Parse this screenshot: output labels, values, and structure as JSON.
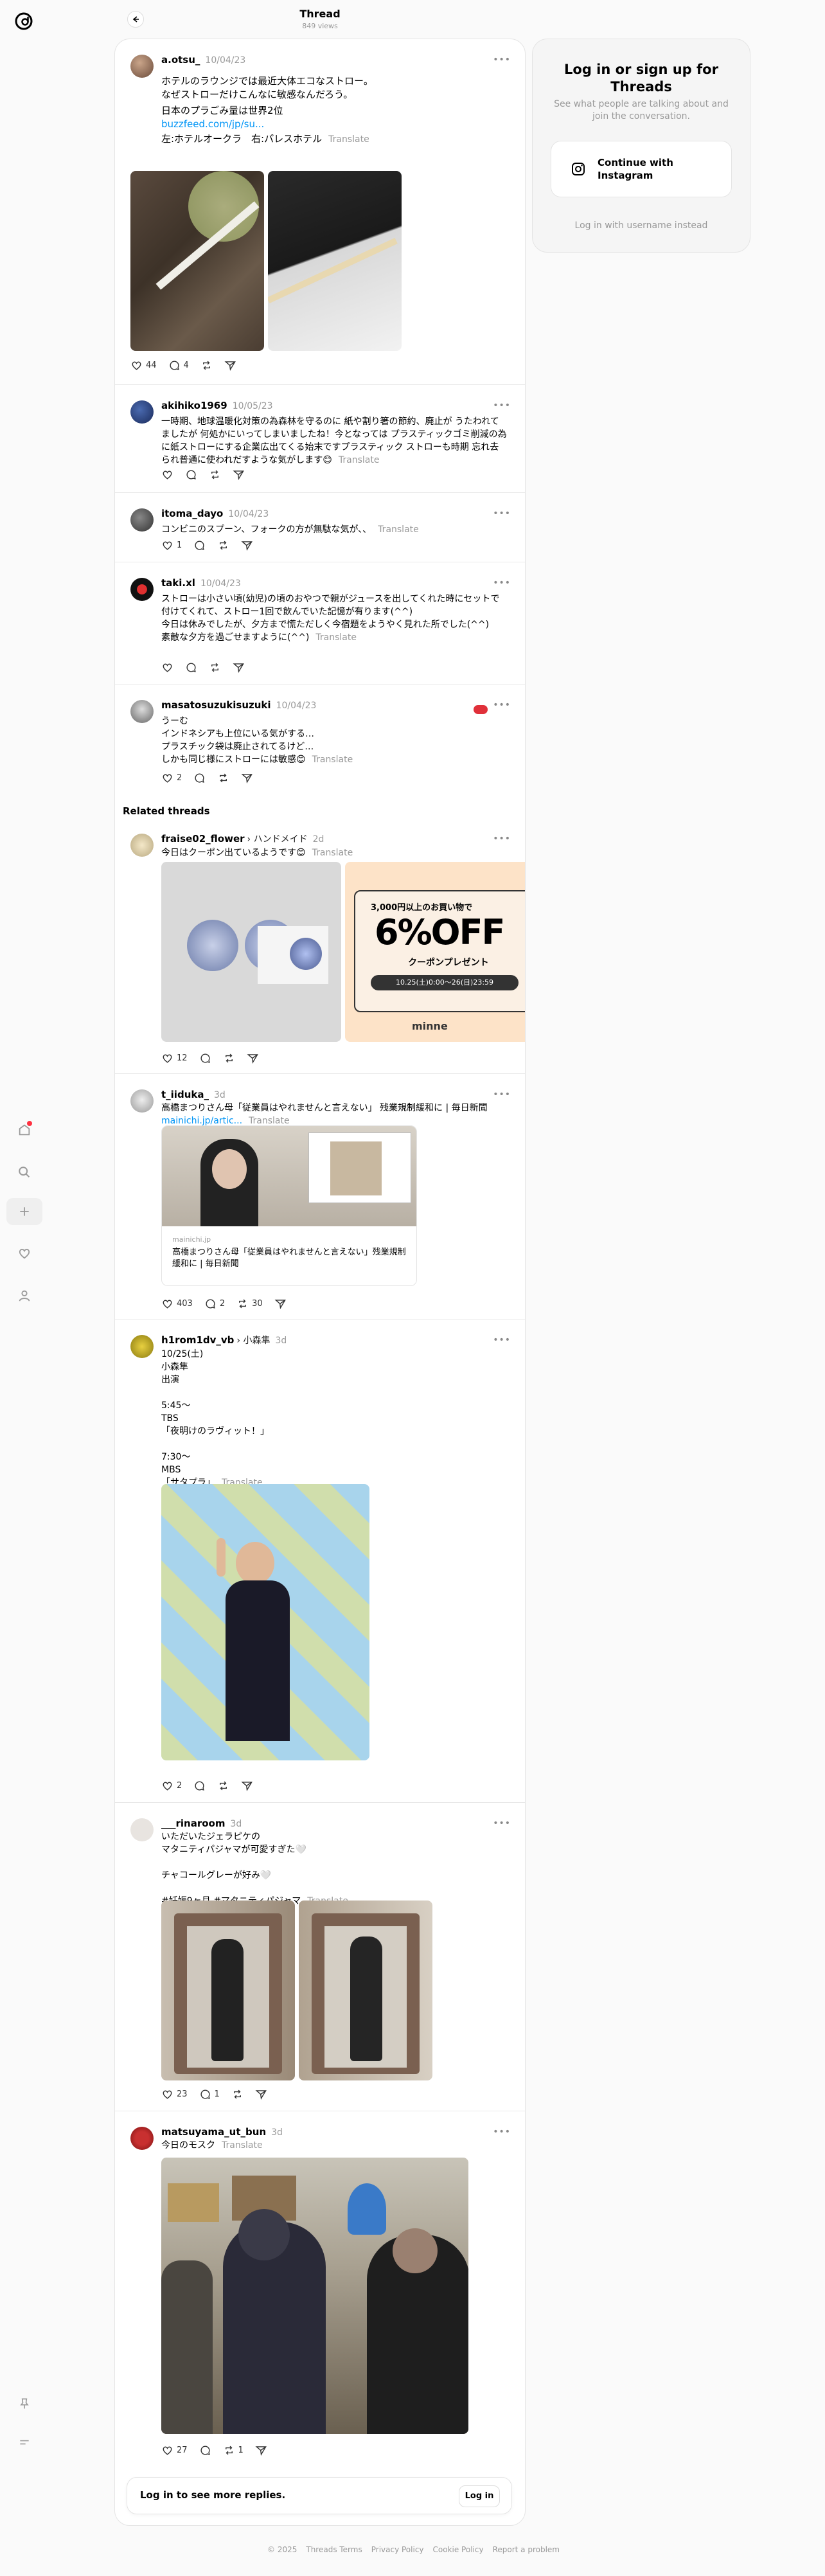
{
  "header": {
    "title": "Thread",
    "views": "849 views"
  },
  "right_panel": {
    "title": "Log in or sign up for Threads",
    "subtitle": "See what people are talking about and join the conversation.",
    "button": "Continue with Instagram",
    "alt": "Log in with username instead"
  },
  "translate": "Translate",
  "posts": [
    {
      "user": "a.otsu_",
      "date": "10/04/23",
      "lines": "ホテルのラウンジでは最近大体エコなストロー。\nなぜストローだけこんなに敏感なんだろう。",
      "line2": "日本のプラごみ量は世界2位",
      "link": "buzzfeed.com/jp/su...",
      "caption": "左:ホテルオークラ　右:パレスホテル",
      "likes": "44",
      "replies": "4"
    },
    {
      "user": "akihiko1969",
      "date": "10/05/23",
      "text": "一時期、地球温暖化対策の為森林を守るのに 紙や割り箸の節約、廃止が うたわれてましたが 何処かにいってしまいましたね！今となっては プラスティックゴミ削減の為に紙ストローにする企業広出てくる始末ですプラスティック ストローも時期 忘れ去られ普通に使われだすような気がします😊"
    },
    {
      "user": "itoma_dayo",
      "date": "10/04/23",
      "text": "コンビニのスプーン、フォークの方が無駄な気が、、",
      "likes": "1"
    },
    {
      "user": "taki.xl",
      "date": "10/04/23",
      "text": "ストローは小さい頃(幼児)の頃のおやつで親がジュースを出してくれた時にセットで付けてくれて、ストロー1回で飲んでいた記憶が有ります(^^)\n今日は休みでしたが、夕方まで慌ただしく今宿題をようやく見れた所でした(^^)\n素敵な夕方を過ごせますように(^^)"
    },
    {
      "user": "masatosuzukisuzuki",
      "date": "10/04/23",
      "text": "うーむ\nインドネシアも上位にいる気がする…\nプラスチック袋は廃止されてるけど…\nしかも同じ様にストローには敏感😊",
      "likes": "2"
    }
  ],
  "related_title": "Related threads",
  "related": [
    {
      "user": "fraise02_flower",
      "crumb": "ハンドメイド",
      "date": "2d",
      "text": "今日はクーポン出ているようです😊",
      "coupon": {
        "line1": "3,000円以上のお買い物で",
        "big": "6%OFF",
        "line2": "クーポンプレゼント",
        "dates": "10.25(土)0:00〜26(日)23:59",
        "brand": "minne"
      },
      "likes": "12"
    },
    {
      "user": "t_iiduka_",
      "date": "3d",
      "text": "高橋まつりさん母「従業員はやれませんと言えない」 残業規制緩和に | 毎日新聞 ",
      "link": "mainichi.jp/artic...",
      "card_domain": "mainichi.jp",
      "card_title": "高橋まつりさん母「従業員はやれませんと言えない」残業規制緩和に | 毎日新聞",
      "likes": "403",
      "replies": "2",
      "reposts": "30"
    },
    {
      "user": "h1rom1dv_vb",
      "crumb": "小森隼",
      "date": "3d",
      "text": "10/25(土)\n小森隼\n出演\n\n5:45〜\nTBS\n「夜明けのラヴィット！」\n\n7:30〜\nMBS\n「サタプラ」",
      "likes": "2"
    },
    {
      "user": "___rinaroom",
      "date": "3d",
      "text": "いただいたジェラピケの\nマタニティパジャマが可愛すぎた🤍\n\nチャコールグレーが好み🤍\n\n#妊娠9ヶ月 #マタニティパジャマ",
      "likes": "23",
      "replies": "1"
    },
    {
      "user": "matsuyama_ut_bun",
      "date": "3d",
      "text": "今日のモスク",
      "likes": "27",
      "reposts": "1"
    }
  ],
  "login_bar": {
    "text": "Log in to see more replies.",
    "button": "Log in"
  },
  "footer": [
    "© 2025",
    "Threads Terms",
    "Privacy Policy",
    "Cookie Policy",
    "Report a problem"
  ]
}
